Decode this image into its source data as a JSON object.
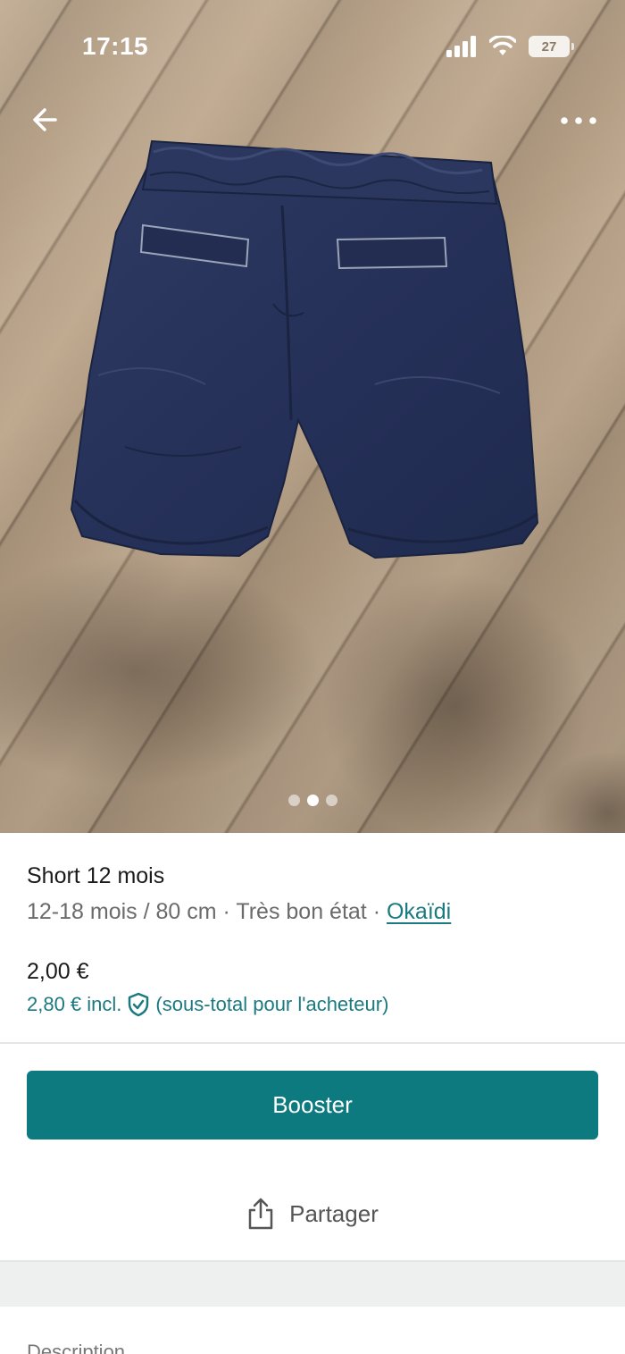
{
  "status_bar": {
    "time": "17:15",
    "battery": "27"
  },
  "navigation": {
    "back_icon": "arrow-left-icon",
    "more_icon": "more-horizontal-icon"
  },
  "gallery": {
    "image_count": 3,
    "active_index": 1
  },
  "item": {
    "title": "Short 12 mois",
    "size": "12-18 mois / 80 cm",
    "separator": "·",
    "condition": "Très bon état",
    "brand": "Okaïdi",
    "price": "2,00 €",
    "price_incl": "2,80 € incl.",
    "price_incl_note": "(sous-total pour l'acheteur)"
  },
  "actions": {
    "booster_label": "Booster",
    "share_label": "Partager"
  },
  "sections": {
    "description_label": "Description"
  },
  "colors": {
    "accent": "#0d7a7f",
    "link": "#1a7a7f"
  }
}
